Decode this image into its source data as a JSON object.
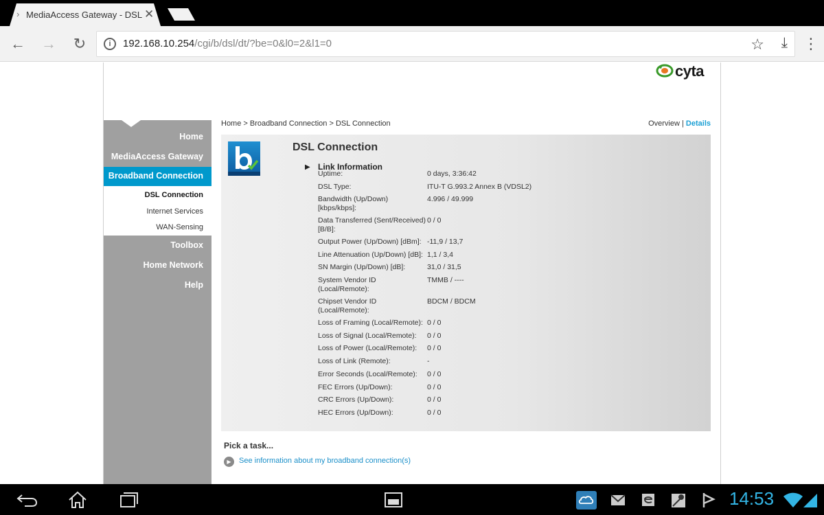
{
  "browser": {
    "tab_title": "MediaAccess Gateway - DSL",
    "url_host": "192.168.10.254",
    "url_path": "/cgi/b/dsl/dt/?be=0&l0=2&l1=0"
  },
  "header": {
    "logo_text": "cyta"
  },
  "sidebar": {
    "items": [
      {
        "label": "Home"
      },
      {
        "label": "MediaAccess Gateway"
      },
      {
        "label": "Broadband Connection"
      },
      {
        "label": "Toolbox"
      },
      {
        "label": "Home Network"
      },
      {
        "label": "Help"
      }
    ],
    "sub_items": [
      {
        "label": "DSL Connection"
      },
      {
        "label": "Internet Services"
      },
      {
        "label": "WAN-Sensing"
      }
    ]
  },
  "breadcrumb": "Home > Broadband Connection > DSL Connection",
  "view_links": {
    "overview": "Overview",
    "separator": " | ",
    "details": "Details"
  },
  "panel": {
    "title": "DSL Connection",
    "section_title": "Link Information",
    "rows": [
      {
        "label": "Uptime:",
        "value": "0 days, 3:36:42"
      },
      {
        "label": "DSL Type:",
        "value": "ITU-T G.993.2 Annex B (VDSL2)"
      },
      {
        "label": "Bandwidth (Up/Down) [kbps/kbps]:",
        "value": "4.996 / 49.999"
      },
      {
        "label": "Data Transferred (Sent/Received) [B/B]:",
        "value": "0 / 0"
      },
      {
        "label": "Output Power (Up/Down) [dBm]:",
        "value": "-11,9 / 13,7"
      },
      {
        "label": "Line Attenuation (Up/Down) [dB]:",
        "value": "1,1 / 3,4"
      },
      {
        "label": "SN Margin (Up/Down) [dB]:",
        "value": "31,0 / 31,5"
      },
      {
        "label": "System Vendor ID (Local/Remote):",
        "value": "TMMB / ----"
      },
      {
        "label": "Chipset Vendor ID (Local/Remote):",
        "value": "BDCM / BDCM"
      },
      {
        "label": "Loss of Framing (Local/Remote):",
        "value": "0 / 0"
      },
      {
        "label": "Loss of Signal (Local/Remote):",
        "value": "0 / 0"
      },
      {
        "label": "Loss of Power (Local/Remote):",
        "value": "0 / 0"
      },
      {
        "label": "Loss of Link (Remote):",
        "value": "-"
      },
      {
        "label": "Error Seconds (Local/Remote):",
        "value": "0 / 0"
      },
      {
        "label": "FEC Errors (Up/Down):",
        "value": "0 / 0"
      },
      {
        "label": "CRC Errors (Up/Down):",
        "value": "0 / 0"
      },
      {
        "label": "HEC Errors (Up/Down):",
        "value": "0 / 0"
      }
    ]
  },
  "tasks": {
    "title": "Pick a task...",
    "link": "See information about my broadband connection(s)"
  },
  "system_bar": {
    "clock": "14:53"
  },
  "colors": {
    "accent": "#0099cc",
    "link": "#1a8fc9",
    "sidebar": "#a0a0a0",
    "clock": "#33b5e5"
  }
}
